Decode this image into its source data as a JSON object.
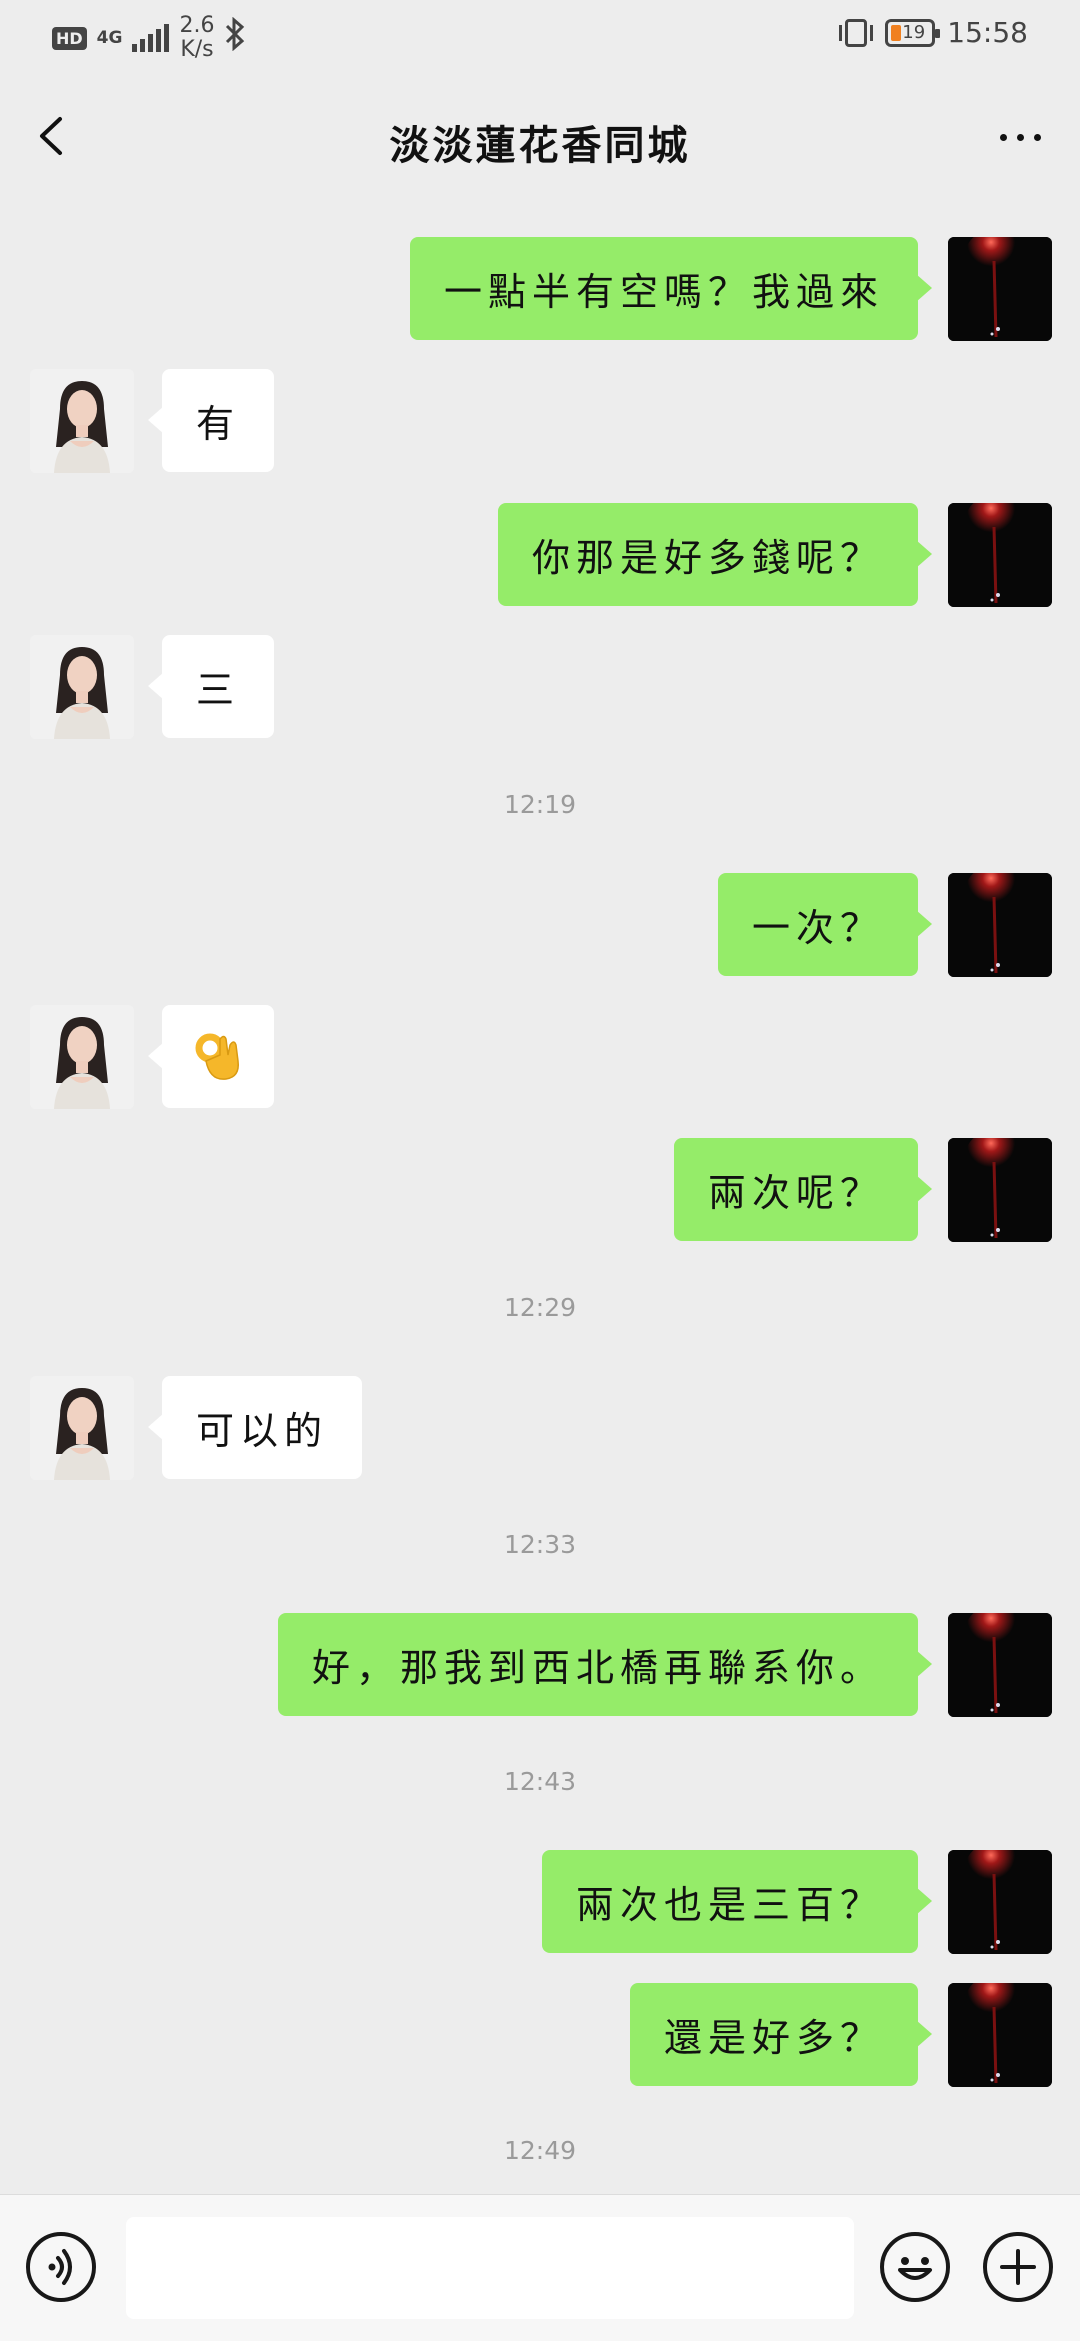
{
  "status_bar": {
    "hd": "HD",
    "network": "4G",
    "speed_value": "2.6",
    "speed_unit": "K/s",
    "battery_level": "19",
    "time": "15:58",
    "battery_color": "#f08020"
  },
  "header": {
    "title": "淡淡蓮花香同城",
    "back_icon": "chevron-left-icon",
    "more_icon": "more-dots-icon"
  },
  "messages": [
    {
      "type": "self",
      "text": "一點半有空嗎？我過來"
    },
    {
      "type": "other",
      "text": "有"
    },
    {
      "type": "self",
      "text": "你那是好多錢呢？"
    },
    {
      "type": "other",
      "text": "三"
    },
    {
      "type": "time",
      "text": "12:19"
    },
    {
      "type": "self",
      "text": "一次？"
    },
    {
      "type": "other",
      "emoji": "ok-hand-emoji"
    },
    {
      "type": "self",
      "text": "兩次呢？"
    },
    {
      "type": "time",
      "text": "12:29"
    },
    {
      "type": "other",
      "text": "可以的"
    },
    {
      "type": "time",
      "text": "12:33"
    },
    {
      "type": "self",
      "text": "好，那我到西北橋再聯系你。"
    },
    {
      "type": "time",
      "text": "12:43"
    },
    {
      "type": "self",
      "text": "兩次也是三百？"
    },
    {
      "type": "self",
      "text": "還是好多？"
    },
    {
      "type": "time",
      "text": "12:49"
    }
  ],
  "input_bar": {
    "voice_icon": "voice-icon",
    "emoji_icon": "emoji-icon",
    "plus_icon": "plus-icon",
    "input_value": ""
  },
  "colors": {
    "background": "#ededed",
    "self_bubble": "#95ec69",
    "other_bubble": "#ffffff",
    "timestamp": "#9a9a9a"
  }
}
